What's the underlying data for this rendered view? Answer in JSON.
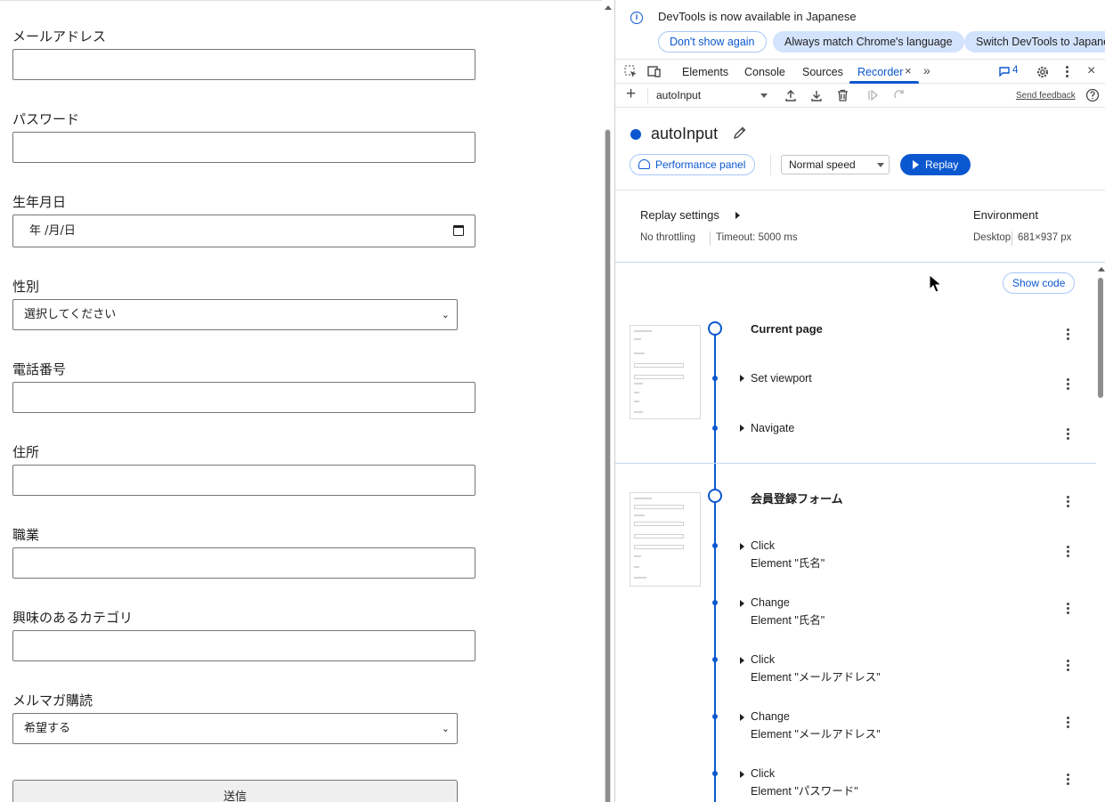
{
  "form": {
    "fields": [
      {
        "label": "メールアドレス",
        "value": ""
      },
      {
        "label": "パスワード",
        "value": ""
      },
      {
        "label": "生年月日",
        "value": "年 /月/日"
      },
      {
        "label": "性別",
        "value": "選択してください"
      },
      {
        "label": "電話番号",
        "value": ""
      },
      {
        "label": "住所",
        "value": ""
      },
      {
        "label": "職業",
        "value": ""
      },
      {
        "label": "興味のあるカテゴリ",
        "value": ""
      },
      {
        "label": "メルマガ購読",
        "value": "希望する"
      }
    ],
    "submit_label": "送信"
  },
  "devtools": {
    "infobar": {
      "message": "DevTools is now available in Japanese",
      "dont_show": "Don't show again",
      "always_match": "Always match Chrome's language",
      "switch": "Switch DevTools to Japanese"
    },
    "tabs": {
      "elements": "Elements",
      "console": "Console",
      "sources": "Sources",
      "recorder": "Recorder",
      "issues_count": "4"
    },
    "recorder": {
      "selected_recording": "autoInput",
      "send_feedback": "Send feedback",
      "title": "autoInput",
      "performance_panel": "Performance panel",
      "speed": "Normal speed",
      "replay": "Replay",
      "replay_settings_label": "Replay settings",
      "throttling": "No throttling",
      "timeout": "Timeout: 5000 ms",
      "environment_label": "Environment",
      "device": "Desktop",
      "viewport": "681×937 px",
      "show_code": "Show code"
    },
    "sections": [
      {
        "title": "Current page",
        "steps": [
          {
            "title": "Set viewport",
            "subtitle": ""
          },
          {
            "title": "Navigate",
            "subtitle": ""
          }
        ]
      },
      {
        "title": "会員登録フォーム",
        "steps": [
          {
            "title": "Click",
            "subtitle": "Element \"氏名\""
          },
          {
            "title": "Change",
            "subtitle": "Element \"氏名\""
          },
          {
            "title": "Click",
            "subtitle": "Element \"メールアドレス\""
          },
          {
            "title": "Change",
            "subtitle": "Element \"メールアドレス\""
          },
          {
            "title": "Click",
            "subtitle": "Element \"パスワード\""
          }
        ]
      }
    ]
  }
}
